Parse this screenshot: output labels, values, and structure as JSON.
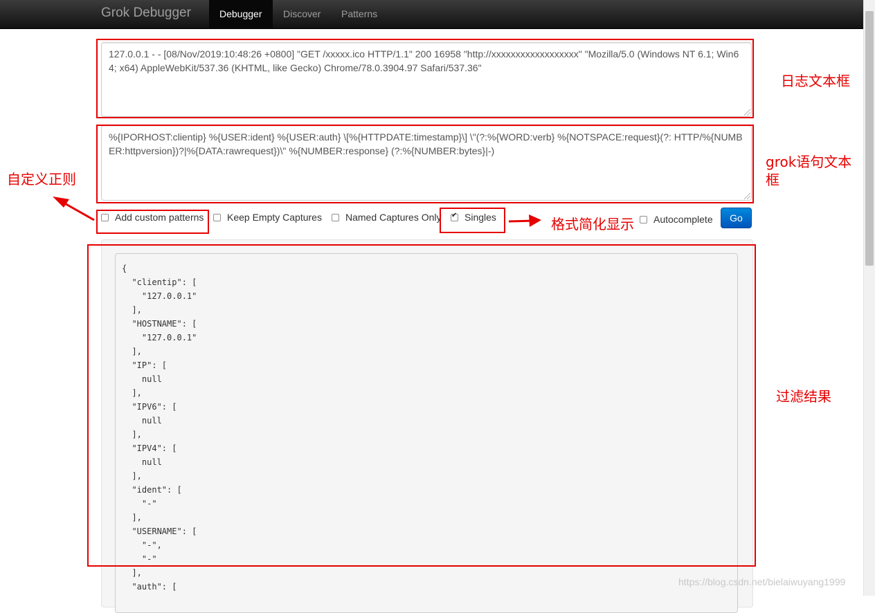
{
  "navbar": {
    "brand": "Grok Debugger",
    "tabs": [
      "Debugger",
      "Discover",
      "Patterns"
    ],
    "active_tab": "Debugger"
  },
  "log_input": {
    "value": "127.0.0.1 - - [08/Nov/2019:10:48:26 +0800] \"GET /xxxxx.ico HTTP/1.1\" 200 16958 \"http://xxxxxxxxxxxxxxxxxx\" \"Mozilla/5.0 (Windows NT 6.1; Win64; x64) AppleWebKit/537.36 (KHTML, like Gecko) Chrome/78.0.3904.97 Safari/537.36\""
  },
  "pattern_input": {
    "value": "%{IPORHOST:clientip} %{USER:ident} %{USER:auth} \\[%{HTTPDATE:timestamp}\\] \\\"(?:%{WORD:verb} %{NOTSPACE:request}(?: HTTP/%{NUMBER:httpversion})?|%{DATA:rawrequest})\\\" %{NUMBER:response} (?:%{NUMBER:bytes}|-)"
  },
  "options": {
    "add_custom_patterns": {
      "label": "Add custom patterns",
      "checked": false
    },
    "keep_empty_captures": {
      "label": "Keep Empty Captures",
      "checked": false
    },
    "named_captures_only": {
      "label": "Named Captures Only",
      "checked": false
    },
    "singles": {
      "label": "Singles",
      "checked": true
    },
    "autocomplete": {
      "label": "Autocomplete",
      "checked": false
    },
    "go_label": "Go"
  },
  "result_text": "{\n  \"clientip\": [\n    \"127.0.0.1\"\n  ],\n  \"HOSTNAME\": [\n    \"127.0.0.1\"\n  ],\n  \"IP\": [\n    null\n  ],\n  \"IPV6\": [\n    null\n  ],\n  \"IPV4\": [\n    null\n  ],\n  \"ident\": [\n    \"-\"\n  ],\n  \"USERNAME\": [\n    \"-\",\n    \"-\"\n  ],\n  \"auth\": [",
  "annotations": {
    "log_box": "日志文本框",
    "grok_box": "grok语句文本框",
    "custom_regex": "自定义正则",
    "singles_note": "格式简化显示",
    "result_note": "过滤结果"
  },
  "watermark": "https://blog.csdn.net/bielaiwuyang1999",
  "colors": {
    "annotation": "#e60000",
    "go_button": "#0066cc",
    "navbar": "#222222"
  }
}
